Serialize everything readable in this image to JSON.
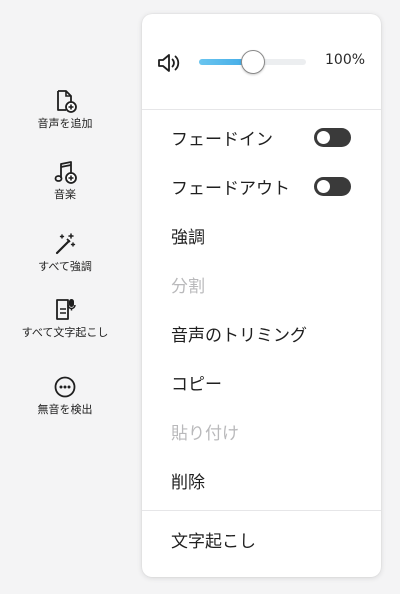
{
  "sidebar": {
    "tools": [
      {
        "label": "音声を追加",
        "icon": "file-add-icon"
      },
      {
        "label": "音楽",
        "icon": "music-add-icon"
      },
      {
        "label": "すべて強調",
        "icon": "magic-wand-icon"
      },
      {
        "label": "すべて文字起こし",
        "icon": "transcribe-icon"
      },
      {
        "label": "無音を検出",
        "icon": "detect-silence-icon"
      }
    ]
  },
  "menu": {
    "volume": {
      "value_label": "100%",
      "level_fraction": 0.5,
      "icon": "speaker-icon",
      "accent": "#3fa9e6"
    },
    "items": [
      {
        "label": "フェードイン",
        "toggle": false
      },
      {
        "label": "フェードアウト",
        "toggle": false
      },
      {
        "label": "強調"
      },
      {
        "label": "分割",
        "disabled": true
      },
      {
        "label": "音声のトリミング"
      },
      {
        "label": "コピー"
      },
      {
        "label": "貼り付け",
        "disabled": true
      },
      {
        "label": "削除"
      },
      {
        "label": "文字起こし"
      }
    ]
  }
}
